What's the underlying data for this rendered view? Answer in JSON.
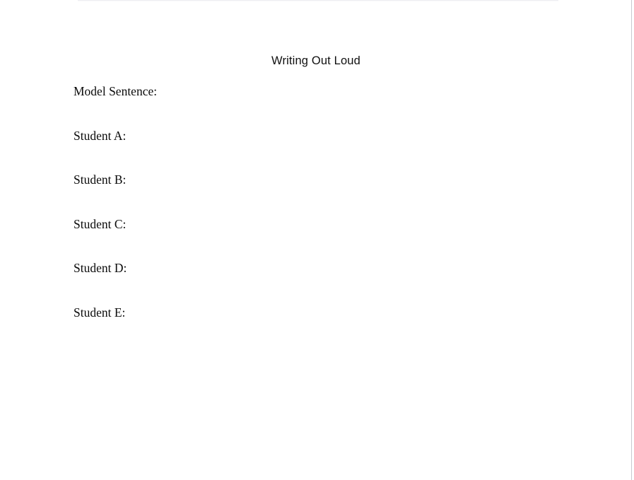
{
  "document": {
    "title": "Writing Out Loud",
    "background_color": "#ffffff",
    "text_color": "#0b0b0b",
    "page_edge_color": "#c9c9cf",
    "lines": [
      {
        "label": "Model Sentence:"
      },
      {
        "label": "Student A:"
      },
      {
        "label": "Student B:"
      },
      {
        "label": "Student C:"
      },
      {
        "label": "Student D:"
      },
      {
        "label": "Student E:"
      }
    ]
  }
}
